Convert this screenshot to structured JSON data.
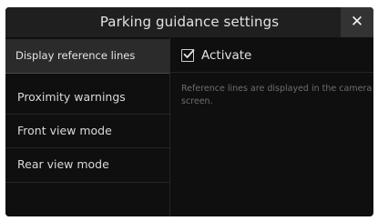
{
  "dialog": {
    "title": "Parking guidance settings",
    "close_label": "✕"
  },
  "sidebar": {
    "items": [
      {
        "label": "Display reference lines",
        "selected": true
      },
      {
        "label": "Proximity warnings",
        "selected": false
      },
      {
        "label": "Front view mode",
        "selected": false
      },
      {
        "label": "Rear view mode",
        "selected": false
      }
    ]
  },
  "content": {
    "activate": {
      "label": "Activate",
      "checked": true
    },
    "description": "Reference lines are displayed in the camera screen."
  },
  "colors": {
    "panel_background": "#0f0f0f",
    "header_background": "#1f1f1f",
    "close_button_background": "#333333",
    "selected_item_background": "#2b2b2b",
    "text_primary": "#e2e2e2",
    "text_secondary": "#6e6e6e"
  }
}
